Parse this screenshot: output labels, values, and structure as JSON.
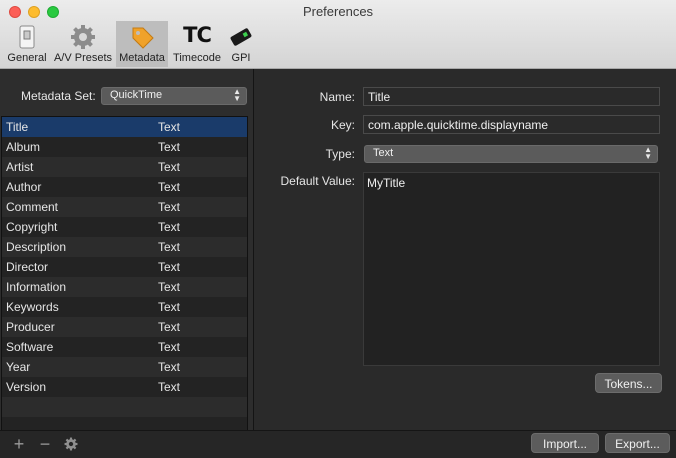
{
  "window": {
    "title": "Preferences"
  },
  "toolbar": {
    "tabs": [
      {
        "label": "General",
        "icon": "general-switch-icon"
      },
      {
        "label": "A/V Presets",
        "icon": "gear-icon"
      },
      {
        "label": "Metadata",
        "icon": "tag-icon"
      },
      {
        "label": "Timecode",
        "icon_text": "TC"
      },
      {
        "label": "GPI",
        "icon": "gpi-device-icon"
      }
    ],
    "selected": "Metadata"
  },
  "metadata_set": {
    "label": "Metadata Set:",
    "value": "QuickTime"
  },
  "list": {
    "rows": [
      {
        "name": "Title",
        "type": "Text"
      },
      {
        "name": "Album",
        "type": "Text"
      },
      {
        "name": "Artist",
        "type": "Text"
      },
      {
        "name": "Author",
        "type": "Text"
      },
      {
        "name": "Comment",
        "type": "Text"
      },
      {
        "name": "Copyright",
        "type": "Text"
      },
      {
        "name": "Description",
        "type": "Text"
      },
      {
        "name": "Director",
        "type": "Text"
      },
      {
        "name": "Information",
        "type": "Text"
      },
      {
        "name": "Keywords",
        "type": "Text"
      },
      {
        "name": "Producer",
        "type": "Text"
      },
      {
        "name": "Software",
        "type": "Text"
      },
      {
        "name": "Year",
        "type": "Text"
      },
      {
        "name": "Version",
        "type": "Text"
      }
    ],
    "selected_index": 0
  },
  "detail": {
    "name_label": "Name:",
    "name_value": "Title",
    "key_label": "Key:",
    "key_value": "com.apple.quicktime.displayname",
    "type_label": "Type:",
    "type_value": "Text",
    "default_label": "Default Value:",
    "default_value": "MyTitle",
    "tokens_button": "Tokens..."
  },
  "bottom": {
    "add_symbol": "+",
    "remove_symbol": "−",
    "import_button": "Import...",
    "export_button": "Export..."
  },
  "colors": {
    "selection": "#1a3b6a",
    "close": "#fc5f57",
    "minimize": "#fdbc2e",
    "maximize": "#29c940"
  }
}
